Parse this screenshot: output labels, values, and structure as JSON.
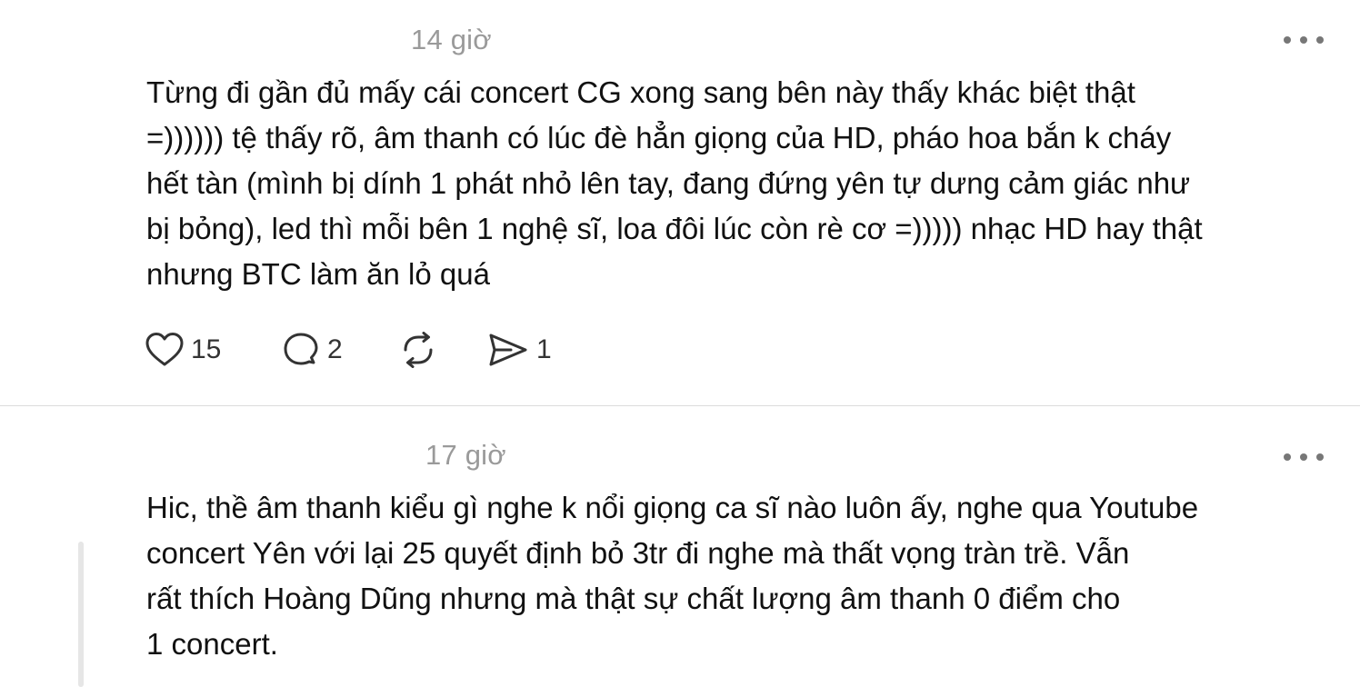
{
  "posts": [
    {
      "timestamp": "14 giờ",
      "lines": [
        "Từng đi gần đủ mấy cái concert CG xong sang bên này thấy khác biệt thật",
        "=)))))) tệ thấy rõ, âm thanh có lúc đè hẳn giọng của HD, pháo hoa bắn k cháy",
        "hết tàn (mình bị dính 1 phát nhỏ lên tay, đang đứng yên tự dưng cảm giác như",
        "bị bỏng), led thì mỗi bên 1 nghệ sĩ, loa đôi lúc còn rè cơ =))))) nhạc HD hay thật",
        "nhưng BTC làm ăn lỏ quá"
      ],
      "actions": {
        "like": {
          "icon": "heart-icon",
          "count": "15"
        },
        "reply": {
          "icon": "comment-icon",
          "count": "2"
        },
        "repost": {
          "icon": "repost-icon"
        },
        "share": {
          "icon": "send-icon",
          "count": "1"
        }
      },
      "more_icon": "ellipsis-icon"
    },
    {
      "timestamp": "17 giờ",
      "lines": [
        "Hic, thề âm thanh kiểu gì nghe k nổi giọng ca sĩ nào luôn ấy, nghe qua Youtube",
        "concert Yên với lại 25 quyết định bỏ 3tr đi nghe mà thất vọng tràn trề. Vẫn",
        "rất thích Hoàng Dũng nhưng mà thật sự chất lượng âm thanh 0 điểm cho",
        "1 concert."
      ],
      "more_icon": "ellipsis-icon"
    }
  ],
  "colors": {
    "text": "#111111",
    "timestamp": "#9a9a9a",
    "icon": "#333333",
    "divider": "#dcdcdc",
    "thread_line": "#e6e6e6"
  }
}
